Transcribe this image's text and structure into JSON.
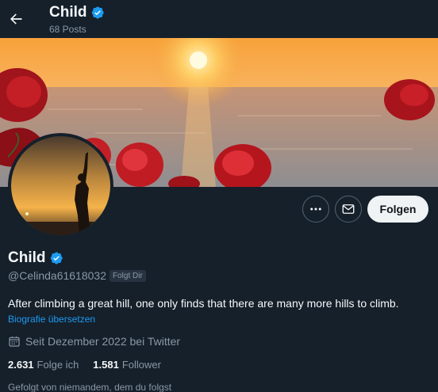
{
  "header": {
    "name": "Child",
    "posts": "68 Posts"
  },
  "profile": {
    "name": "Child",
    "handle": "@Celinda61618032",
    "follows_badge": "Folgt Dir",
    "bio": "After climbing a great hill, one only finds that there are many more hills to climb.",
    "translate_label": "Biografie übersetzen",
    "joined": "Seit Dezember 2022 bei Twitter",
    "following_count": "2.631",
    "following_label": "Folge ich",
    "followers_count": "1.581",
    "followers_label": "Follower",
    "followed_by": "Gefolgt von niemandem, dem du folgst"
  },
  "actions": {
    "follow_label": "Folgen"
  },
  "icons": {
    "back": "arrow-left-icon",
    "verified": "verified-badge-icon",
    "more": "more-dots-icon",
    "message": "envelope-icon",
    "calendar": "calendar-icon"
  },
  "colors": {
    "background": "#15202b",
    "accent": "#1d9bf0",
    "secondary_text": "#8b98a5",
    "follow_button": "#eff3f4"
  }
}
